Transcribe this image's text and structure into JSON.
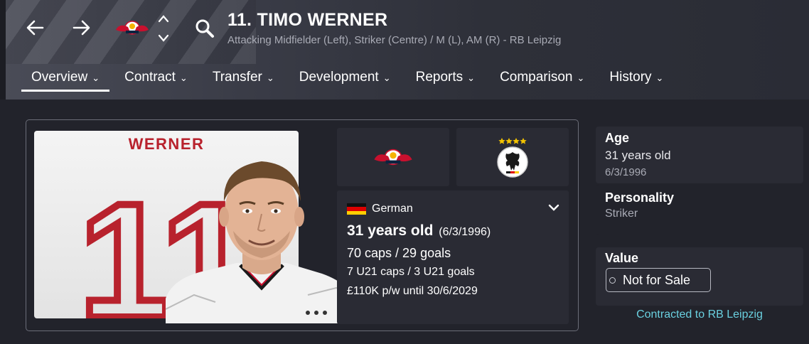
{
  "header": {
    "title": "11. TIMO WERNER",
    "subtitle": "Attacking Midfielder (Left), Striker (Centre) / M (L), AM (R) - RB Leipzig",
    "back_icon": "arrow-left-icon",
    "forward_icon": "arrow-right-icon",
    "search_icon": "search-icon"
  },
  "tabs": [
    {
      "label": "Overview",
      "active": true
    },
    {
      "label": "Contract"
    },
    {
      "label": "Transfer"
    },
    {
      "label": "Development"
    },
    {
      "label": "Reports"
    },
    {
      "label": "Comparison"
    },
    {
      "label": "History"
    }
  ],
  "shirt": {
    "name": "WERNER",
    "number": "11"
  },
  "profile": {
    "nationality": "German",
    "age": "31 years old",
    "dob": "(6/3/1996)",
    "caps": "70 caps / 29 goals",
    "u21": "7 U21 caps / 3 U21 goals",
    "wage": "£110K p/w until 30/6/2029"
  },
  "side": {
    "age_label": "Age",
    "age_value": "31 years old",
    "age_dob": "6/3/1996",
    "personality_label": "Personality",
    "personality_value": "Striker",
    "value_label": "Value",
    "value_value": "Not for Sale",
    "contracted": "Contracted to RB Leipzig"
  },
  "colors": {
    "background": "#22232b",
    "panel": "#2a2b34",
    "accent_cyan": "#6ad0e0",
    "shirt_red": "#b8222d"
  }
}
